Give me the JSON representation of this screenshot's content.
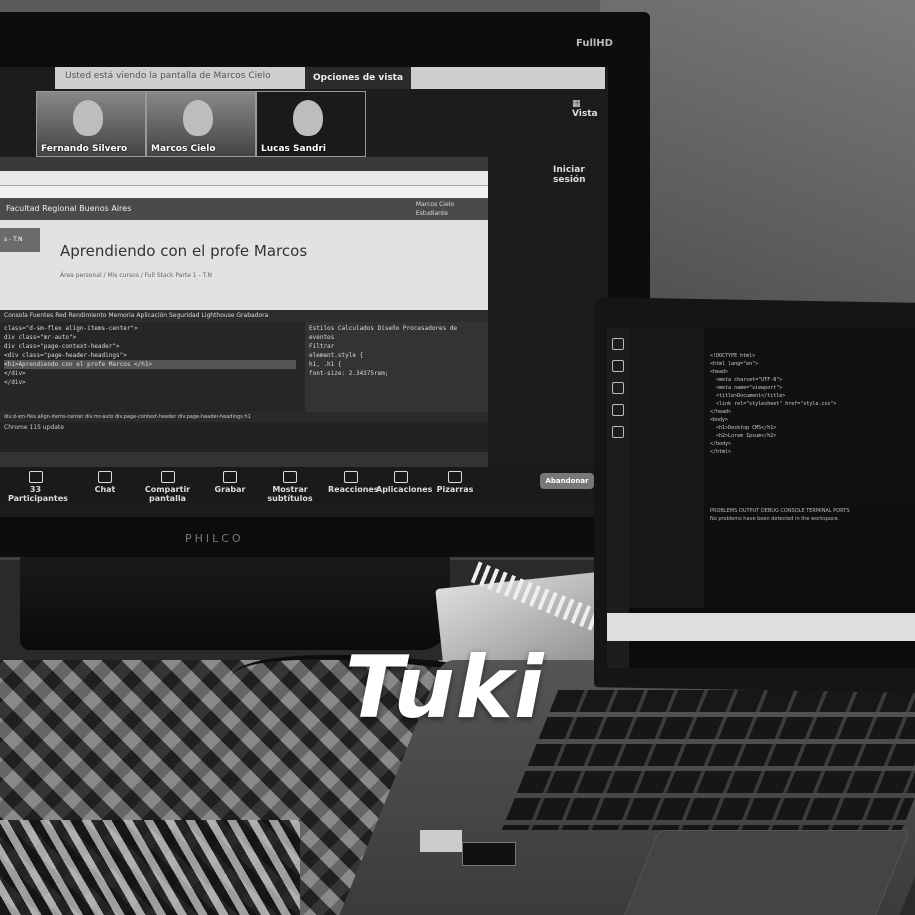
{
  "caption": "Tuki",
  "monitor": {
    "brand": "PHILCO",
    "badge": "FullHD",
    "zoom": {
      "banner": "Usted está viendo la pantalla de Marcos Cielo",
      "view_options": "Opciones de vista",
      "view_button": "Vista",
      "login": "Iniciar sesión",
      "participants": [
        "Fernando Silvero",
        "Marcos Cielo",
        "Lucas Sandri"
      ],
      "toolbar": [
        {
          "label": "Participantes",
          "count": "33"
        },
        {
          "label": "Chat"
        },
        {
          "label": "Compartir pantalla"
        },
        {
          "label": "Grabar"
        },
        {
          "label": "Mostrar subtítulos"
        },
        {
          "label": "Reacciones"
        },
        {
          "label": "Aplicaciones"
        },
        {
          "label": "Pizarras"
        }
      ],
      "leave": "Abandonar"
    },
    "browser": {
      "site_name": "Facultad Regional Buenos Aires",
      "user": "Marcos Cielo",
      "user_role": "Estudiante",
      "page_title": "Aprendiendo con el profe Marcos",
      "breadcrumbs": "Área personal  /  Mis cursos  /  Full Stack Parte 1 - T.N",
      "side_label": "s - T.N",
      "devtools_tabs": "Consola   Fuentes   Red   Rendimiento   Memoria   Aplicación   Seguridad   Lighthouse   Grabadora",
      "styles_tabs": "Estilos   Calculados   Diseño   Procesadores de eventos",
      "filter": "Filtrar",
      "element_style": "element.style {",
      "rule": "h1, .h1 {",
      "rule_prop": "font-size: 2.34375rem;",
      "console_label": "Chrome 115 update",
      "dom_lines": [
        "class=\"d-sm-flex align-items-center\">",
        "div class=\"mr-auto\">",
        "div class=\"page-context-header\">",
        "<div class=\"page-header-headings\">",
        "<h1>Aprendiendo con el profe Marcos </h1>",
        "</div>",
        "</div>"
      ],
      "dom_breadcrumb": "div.d-sm-flex.align-items-center   div.mr-auto   div.page-context-header   div.page-header-headings   h1"
    }
  },
  "laptop": {
    "code_lines": [
      "<!DOCTYPE html>",
      "<html lang=\"en\">",
      "<head>",
      "  <meta charset=\"UTF-8\">",
      "  <meta name=\"viewport\">",
      "  <title>Document</title>",
      "  <link rel=\"stylesheet\" href=\"style.css\">",
      "</head>",
      "<body>",
      "  <h1>Desktop CMS</h1>",
      "  <h2>Lorem Ipsum</h2>",
      "</body>",
      "</html>"
    ],
    "terminal_tabs": "PROBLEMS   OUTPUT   DEBUG CONSOLE   TERMINAL   PORTS",
    "terminal_line": "No problems have been detected in the workspace."
  }
}
